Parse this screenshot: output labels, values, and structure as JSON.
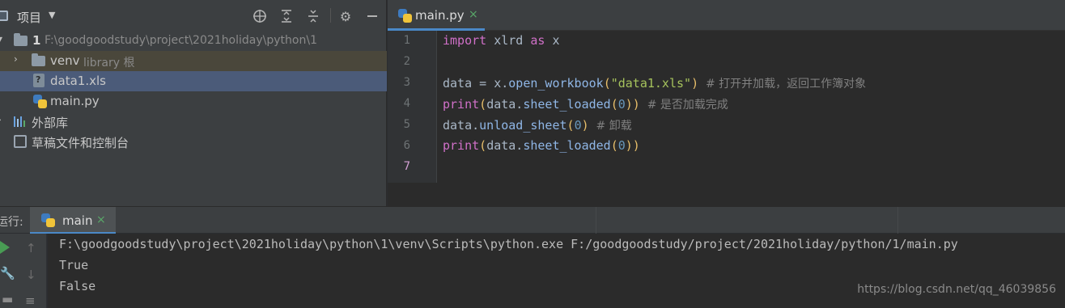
{
  "project_panel": {
    "title": "项目",
    "tree": [
      {
        "name": "1",
        "path": "F:\\goodgoodstudy\\project\\2021holiday\\python\\1"
      },
      {
        "name": "venv",
        "suffix": "library 根"
      },
      {
        "name": "data1.xls"
      },
      {
        "name": "main.py"
      },
      {
        "name": "外部库"
      },
      {
        "name": "草稿文件和控制台"
      }
    ]
  },
  "editor": {
    "tab": {
      "label": "main.py",
      "close": "×"
    },
    "line_numbers": [
      "1",
      "2",
      "3",
      "4",
      "5",
      "6",
      "7"
    ],
    "current_line": "7",
    "code": {
      "l1": {
        "k1": "import",
        "t1": " xlrd ",
        "k2": "as",
        "t2": " x"
      },
      "l3": {
        "t1": "data = x.",
        "f1": "open_workbook",
        "p1": "(",
        "s1": "\"data1.xls\"",
        "p2": ")",
        "c1": "  # 打开并加载，返回工作簿对象"
      },
      "l4": {
        "f1": "print",
        "p1": "(",
        "t1": "data.",
        "a1": "sheet_loaded",
        "p2": "(",
        "n1": "0",
        "p3": "))",
        "c1": "  # 是否加载完成"
      },
      "l5": {
        "t1": "data.",
        "a1": "unload_sheet",
        "p1": "(",
        "n1": "0",
        "p2": ")",
        "c1": "  # 卸载"
      },
      "l6": {
        "f1": "print",
        "p1": "(",
        "t1": "data.",
        "a1": "sheet_loaded",
        "p2": "(",
        "n1": "0",
        "p3": "))"
      }
    }
  },
  "run_panel": {
    "label": "运行:",
    "tab": {
      "label": "main",
      "close": "×"
    },
    "console": [
      "F:\\goodgoodstudy\\project\\2021holiday\\python\\1\\venv\\Scripts\\python.exe F:/goodgoodstudy/project/2021holiday/python/1/main.py",
      "True",
      "False"
    ],
    "watermark": "https://blog.csdn.net/qq_46039856"
  },
  "colors": {
    "accent": "#4a88c7",
    "run_green": "#499c54",
    "selection": "#4b5b79"
  }
}
